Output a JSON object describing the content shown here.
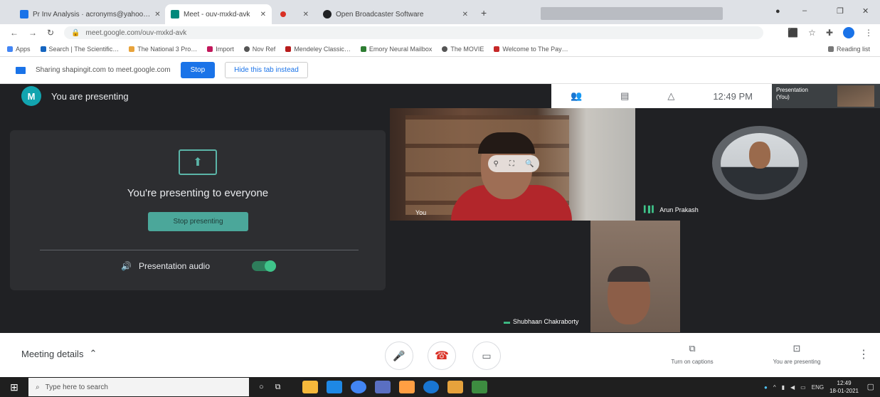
{
  "browser": {
    "tabs": [
      {
        "title": "Pr Inv Analysis · acronyms@yahoo…",
        "icon": "mail-icon",
        "color": "#1a73e8",
        "active": false
      },
      {
        "title": "Meet - ouv-mxkd-avk",
        "icon": "meet-icon",
        "color": "#00897b",
        "active": true
      },
      {
        "title": "",
        "icon": "record-icon",
        "color": "#d93025",
        "active": false
      },
      {
        "title": "Open Broadcaster Software",
        "icon": "obs-icon",
        "color": "#202124",
        "active": false
      }
    ],
    "new_tab": "+",
    "window_controls": {
      "minimize": "–",
      "maximize": "❐",
      "close": "✕"
    },
    "nav": {
      "back": "←",
      "forward": "→",
      "reload": "↻"
    },
    "url": "meet.google.com/ouv-mxkd-avk",
    "bookmarks": [
      {
        "label": "Apps",
        "color": "#4285f4"
      },
      {
        "label": "Search | The Scientific…",
        "color": "#1565c0"
      },
      {
        "label": "The National 3 Pro…",
        "color": "#e8a33b"
      },
      {
        "label": "Import",
        "color": "#c2185b"
      },
      {
        "label": "Nov Ref",
        "color": "#555555"
      },
      {
        "label": "Mendeley Classic…",
        "color": "#b71c1c"
      },
      {
        "label": "Emory Neural Mailbox",
        "color": "#2e7d32"
      },
      {
        "label": "The MOVIE",
        "color": "#555555"
      },
      {
        "label": "Welcome to The Pay…",
        "color": "#c62828"
      }
    ],
    "reading_list": "Reading list"
  },
  "sharebar": {
    "message": "Sharing shapingit.com to meet.google.com",
    "stop_label": "Stop",
    "hide_label": "Hide this tab instead"
  },
  "meet": {
    "header_avatar": "M",
    "header_title": "You are presenting",
    "present_title": "You're presenting to everyone",
    "stop_presenting": "Stop presenting",
    "audio_label": "Presentation audio",
    "audio_on": true,
    "toolbar_time": "12:49 PM",
    "self_tile_label": "Presentation (You)",
    "participants": [
      {
        "name": "You"
      },
      {
        "name": "Arun Prakash"
      },
      {
        "name": "Shubhaan Chakraborty"
      }
    ]
  },
  "controls": {
    "meeting_details": "Meeting details",
    "captions_label": "Turn on captions",
    "presenting_label": "You are presenting"
  },
  "taskbar": {
    "search_placeholder": "Type here to search",
    "apps": [
      "#888888",
      "#3c6ea8",
      "#f6b93b",
      "#1e88e5",
      "#4285f4",
      "#34a853",
      "#5a6fc2",
      "#ff9f43",
      "#1976d2",
      "#e6a23c",
      "#3d8c40"
    ],
    "tray_lang": "ENG",
    "clock_time": "12:49",
    "clock_date": "18-01-2021"
  }
}
